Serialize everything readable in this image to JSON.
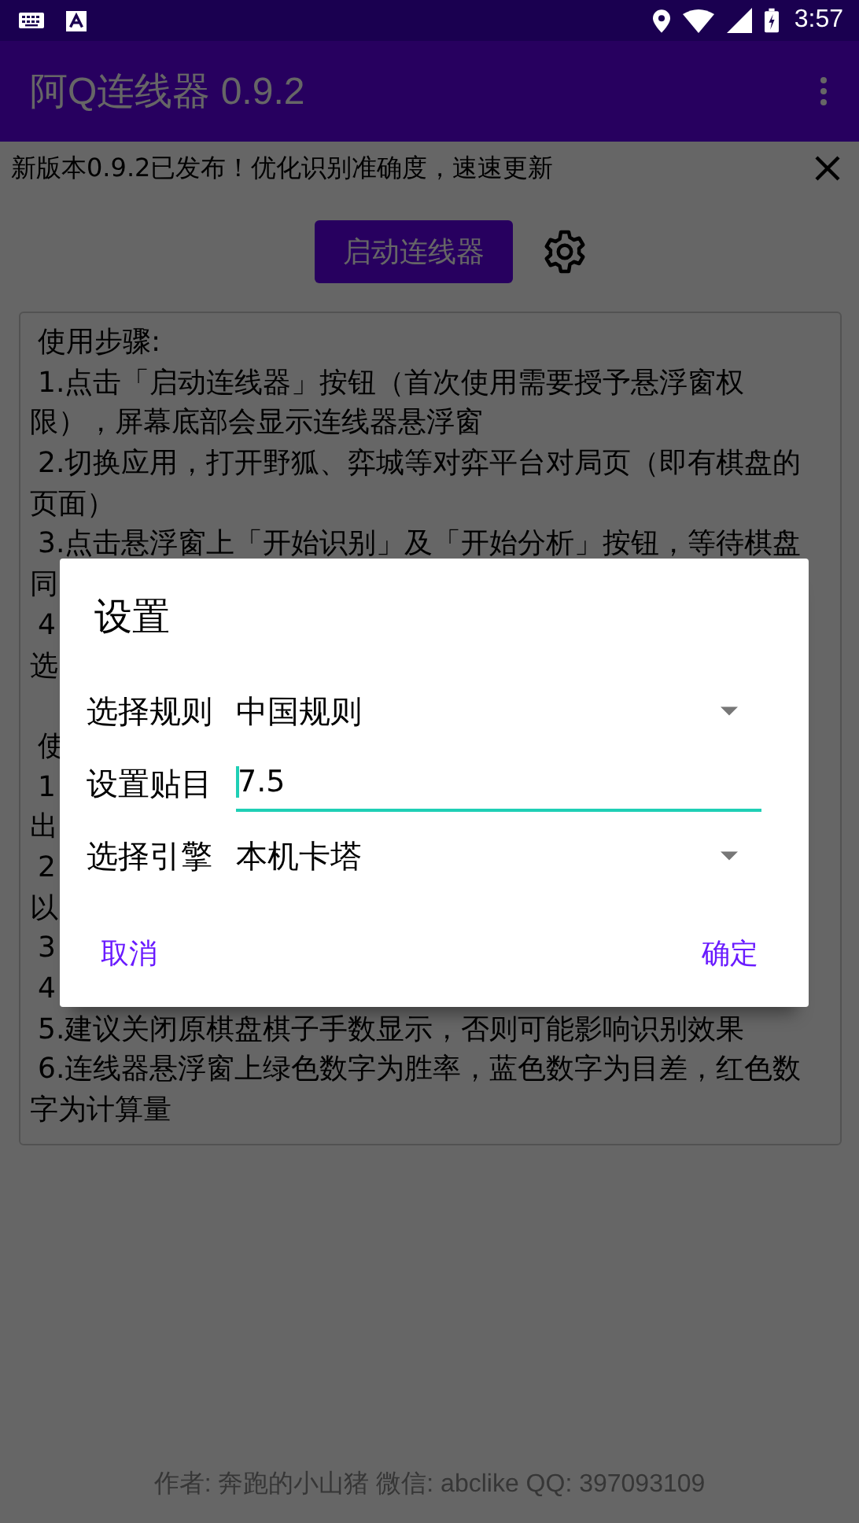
{
  "status_bar": {
    "time": "3:57"
  },
  "app_bar": {
    "title": "阿Q连线器 0.9.2"
  },
  "notice": {
    "text": "新版本0.9.2已发布！优化识别准确度，速速更新"
  },
  "start_button": "启动连线器",
  "instructions": [
    {
      "kind": "start",
      "text": "使用步骤:"
    },
    {
      "kind": "start",
      "text": "1.点击「启动连线器」按钮（首次使用需要授予悬浮窗权"
    },
    {
      "kind": "cont",
      "text": "限），屏幕底部会显示连线器悬浮窗"
    },
    {
      "kind": "start",
      "text": "2.切换应用，打开野狐、弈城等对弈平台对局页（即有棋盘的"
    },
    {
      "kind": "cont",
      "text": "页面）"
    },
    {
      "kind": "start",
      "text": "3.点击悬浮窗上「开始识别」及「开始分析」按钮，等待棋盘"
    },
    {
      "kind": "cont",
      "text": "同"
    },
    {
      "kind": "start",
      "text": "4"
    },
    {
      "kind": "cont",
      "text": "选"
    },
    {
      "kind": "gap"
    },
    {
      "kind": "start",
      "text": "使"
    },
    {
      "kind": "start",
      "text": "1"
    },
    {
      "kind": "cont",
      "text": "出"
    },
    {
      "kind": "start",
      "text": "2"
    },
    {
      "kind": "cont",
      "text": "以"
    },
    {
      "kind": "start",
      "text": "3"
    },
    {
      "kind": "start",
      "text": "4"
    },
    {
      "kind": "start",
      "text": "5.建议关闭原棋盘棋子手数显示，否则可能影响识别效果"
    },
    {
      "kind": "start",
      "text": "6.连线器悬浮窗上绿色数字为胜率，蓝色数字为目差，红色数"
    },
    {
      "kind": "cont",
      "text": "字为计算量"
    }
  ],
  "footer": "作者: 奔跑的小山猪 微信: abclike QQ: 397093109",
  "dialog": {
    "title": "设置",
    "rows": [
      {
        "kind": "dropdown",
        "label": "选择规则",
        "value": "中国规则"
      },
      {
        "kind": "input",
        "label": "设置贴目",
        "value": "7.5"
      },
      {
        "kind": "dropdown",
        "label": "选择引擎",
        "value": "本机卡塔"
      }
    ],
    "buttons": [
      "取消",
      "确定"
    ]
  }
}
